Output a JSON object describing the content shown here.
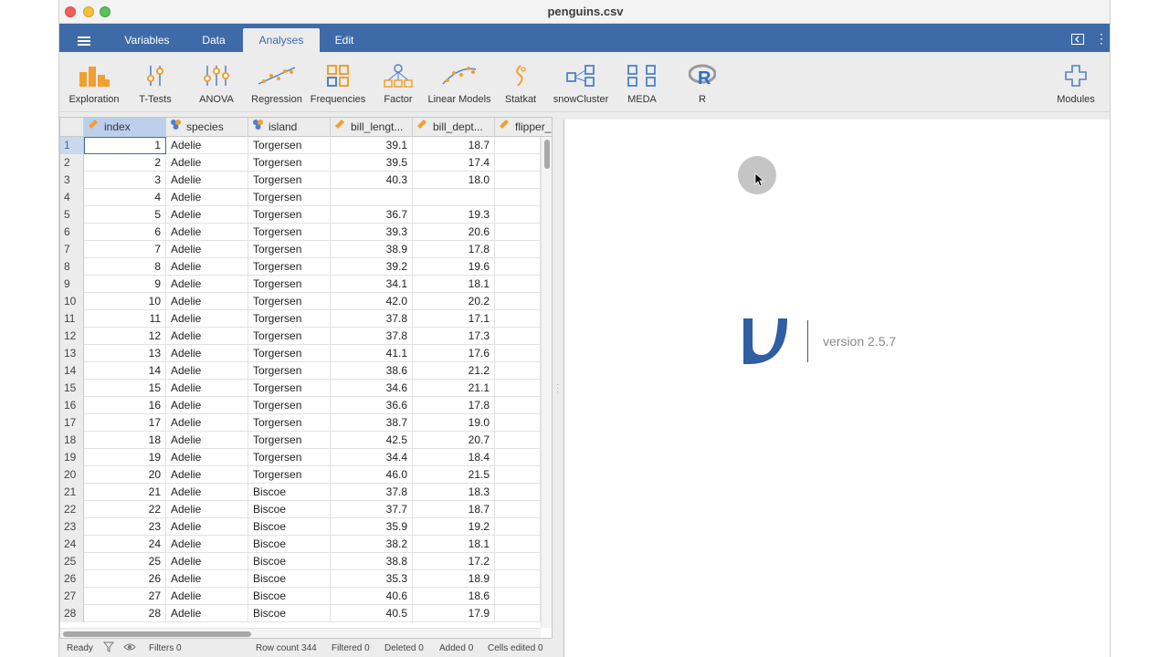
{
  "window": {
    "title": "penguins.csv"
  },
  "menu": {
    "tabs": [
      {
        "label": "Variables"
      },
      {
        "label": "Data"
      },
      {
        "label": "Analyses"
      },
      {
        "label": "Edit"
      }
    ],
    "active_tab": "Analyses"
  },
  "ribbon": {
    "items": [
      {
        "label": "Exploration",
        "icon": "bar-chart-icon"
      },
      {
        "label": "T-Tests",
        "icon": "ttest-icon"
      },
      {
        "label": "ANOVA",
        "icon": "anova-icon"
      },
      {
        "label": "Regression",
        "icon": "regression-icon"
      },
      {
        "label": "Frequencies",
        "icon": "frequencies-icon"
      },
      {
        "label": "Factor",
        "icon": "factor-icon"
      },
      {
        "label": "Linear Models",
        "icon": "linear-models-icon"
      },
      {
        "label": "Statkat",
        "icon": "statkat-icon"
      },
      {
        "label": "snowCluster",
        "icon": "cluster-icon"
      },
      {
        "label": "MEDA",
        "icon": "meda-icon"
      },
      {
        "label": "R",
        "icon": "r-icon"
      }
    ],
    "modules_label": "Modules"
  },
  "table": {
    "columns": [
      {
        "label": "index",
        "icon": "nominal-ruler-icon"
      },
      {
        "label": "species",
        "icon": "nominal-icon"
      },
      {
        "label": "island",
        "icon": "nominal-icon"
      },
      {
        "label": "bill_lengt...",
        "icon": "continuous-ruler-icon"
      },
      {
        "label": "bill_dept...",
        "icon": "continuous-ruler-icon"
      },
      {
        "label": "flipper_",
        "icon": "continuous-ruler-icon"
      }
    ],
    "rows": [
      [
        "1",
        "1",
        "Adelie",
        "Torgersen",
        "39.1",
        "18.7"
      ],
      [
        "2",
        "2",
        "Adelie",
        "Torgersen",
        "39.5",
        "17.4"
      ],
      [
        "3",
        "3",
        "Adelie",
        "Torgersen",
        "40.3",
        "18.0"
      ],
      [
        "4",
        "4",
        "Adelie",
        "Torgersen",
        "",
        ""
      ],
      [
        "5",
        "5",
        "Adelie",
        "Torgersen",
        "36.7",
        "19.3"
      ],
      [
        "6",
        "6",
        "Adelie",
        "Torgersen",
        "39.3",
        "20.6"
      ],
      [
        "7",
        "7",
        "Adelie",
        "Torgersen",
        "38.9",
        "17.8"
      ],
      [
        "8",
        "8",
        "Adelie",
        "Torgersen",
        "39.2",
        "19.6"
      ],
      [
        "9",
        "9",
        "Adelie",
        "Torgersen",
        "34.1",
        "18.1"
      ],
      [
        "10",
        "10",
        "Adelie",
        "Torgersen",
        "42.0",
        "20.2"
      ],
      [
        "11",
        "11",
        "Adelie",
        "Torgersen",
        "37.8",
        "17.1"
      ],
      [
        "12",
        "12",
        "Adelie",
        "Torgersen",
        "37.8",
        "17.3"
      ],
      [
        "13",
        "13",
        "Adelie",
        "Torgersen",
        "41.1",
        "17.6"
      ],
      [
        "14",
        "14",
        "Adelie",
        "Torgersen",
        "38.6",
        "21.2"
      ],
      [
        "15",
        "15",
        "Adelie",
        "Torgersen",
        "34.6",
        "21.1"
      ],
      [
        "16",
        "16",
        "Adelie",
        "Torgersen",
        "36.6",
        "17.8"
      ],
      [
        "17",
        "17",
        "Adelie",
        "Torgersen",
        "38.7",
        "19.0"
      ],
      [
        "18",
        "18",
        "Adelie",
        "Torgersen",
        "42.5",
        "20.7"
      ],
      [
        "19",
        "19",
        "Adelie",
        "Torgersen",
        "34.4",
        "18.4"
      ],
      [
        "20",
        "20",
        "Adelie",
        "Torgersen",
        "46.0",
        "21.5"
      ],
      [
        "21",
        "21",
        "Adelie",
        "Biscoe",
        "37.8",
        "18.3"
      ],
      [
        "22",
        "22",
        "Adelie",
        "Biscoe",
        "37.7",
        "18.7"
      ],
      [
        "23",
        "23",
        "Adelie",
        "Biscoe",
        "35.9",
        "19.2"
      ],
      [
        "24",
        "24",
        "Adelie",
        "Biscoe",
        "38.2",
        "18.1"
      ],
      [
        "25",
        "25",
        "Adelie",
        "Biscoe",
        "38.8",
        "17.2"
      ],
      [
        "26",
        "26",
        "Adelie",
        "Biscoe",
        "35.3",
        "18.9"
      ],
      [
        "27",
        "27",
        "Adelie",
        "Biscoe",
        "40.6",
        "18.6"
      ],
      [
        "28",
        "28",
        "Adelie",
        "Biscoe",
        "40.5",
        "17.9"
      ]
    ]
  },
  "status": {
    "ready": "Ready",
    "filters": "Filters 0",
    "row_count": "Row count 344",
    "filtered": "Filtered 0",
    "deleted": "Deleted 0",
    "added": "Added 0",
    "cells_edited": "Cells edited 0"
  },
  "results": {
    "version": "version 2.5.7"
  },
  "colors": {
    "brand": "#3e6aa8",
    "ribbon_icon": "#f0a030",
    "ribbon_icon_blue": "#4f82c7"
  }
}
